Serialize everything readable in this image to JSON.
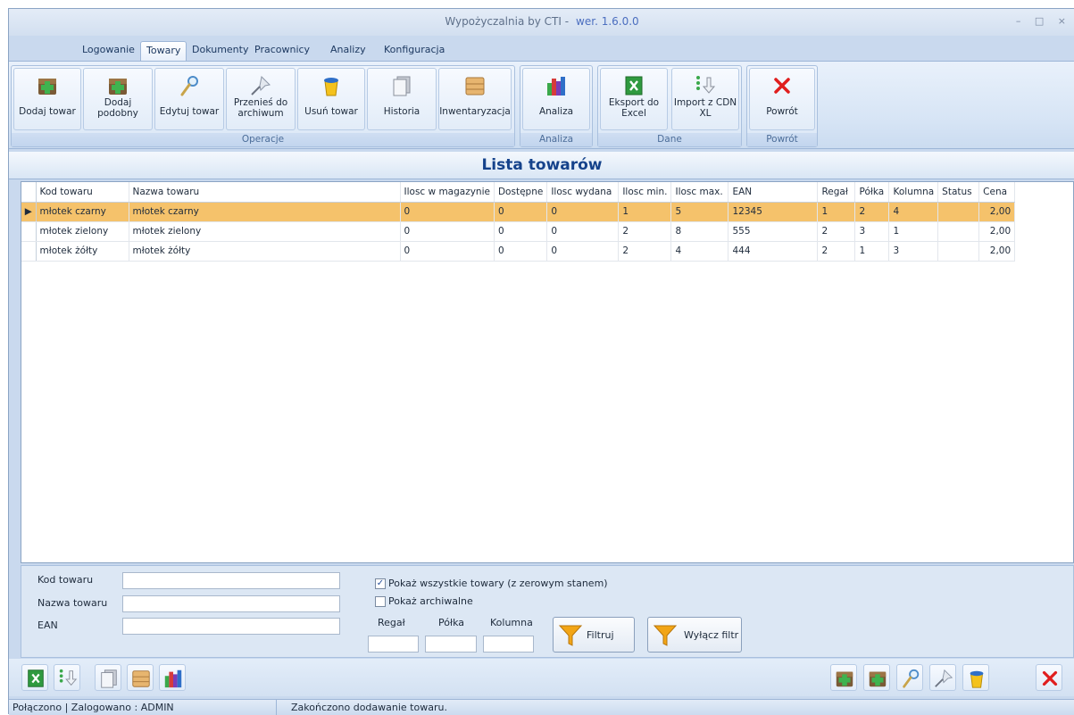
{
  "window": {
    "title": "Wypożyczalnia by CTI -",
    "version": "wer. 1.6.0.0",
    "controls": "– □ ×"
  },
  "tabs": [
    {
      "label": "Logowanie"
    },
    {
      "label": "Towary",
      "active": true
    },
    {
      "label": "Dokumenty"
    },
    {
      "label": "Pracownicy"
    },
    {
      "label": "Analizy"
    },
    {
      "label": "Konfiguracja"
    }
  ],
  "ribbon": {
    "groups": [
      {
        "label": "Operacje"
      },
      {
        "label": "Analiza"
      },
      {
        "label": "Dane"
      },
      {
        "label": "Powrót"
      }
    ],
    "buttons": {
      "add": {
        "label": "Dodaj towar",
        "icon": "add-box-icon"
      },
      "add_similar": {
        "label": "Dodaj podobny",
        "icon": "add-box-icon"
      },
      "edit": {
        "label": "Edytuj towar",
        "icon": "magnifier-icon"
      },
      "archive": {
        "label": "Przenieś do archiwum",
        "icon": "pin-icon"
      },
      "delete": {
        "label": "Usuń towar",
        "icon": "trash-icon"
      },
      "history": {
        "label": "Historia",
        "icon": "documents-icon"
      },
      "inventory": {
        "label": "Inwentaryzacja",
        "icon": "box-icon"
      },
      "analysis": {
        "label": "Analiza",
        "icon": "books-chart-icon"
      },
      "export_excel": {
        "label": "Eksport do Excel",
        "icon": "excel-icon"
      },
      "import_cdn": {
        "label": "Import z CDN XL",
        "icon": "import-arrow-icon"
      },
      "back": {
        "label": "Powrót",
        "icon": "red-x-icon"
      }
    }
  },
  "heading": "Lista towarów",
  "table": {
    "columns": [
      "Kod towaru",
      "Nazwa towaru",
      "Ilosc w magazynie",
      "Dostępne",
      "Ilosc wydana",
      "Ilosc min.",
      "Ilosc max.",
      "EAN",
      "Regał",
      "Półka",
      "Kolumna",
      "Status",
      "Cena"
    ],
    "rows": [
      [
        "młotek czarny",
        "młotek czarny",
        "0",
        "0",
        "0",
        "1",
        "5",
        "12345",
        "1",
        "2",
        "4",
        "",
        "2,00"
      ],
      [
        "młotek zielony",
        "młotek zielony",
        "0",
        "0",
        "0",
        "2",
        "8",
        "555",
        "2",
        "3",
        "1",
        "",
        "2,00"
      ],
      [
        "młotek żółty",
        "młotek żółty",
        "0",
        "0",
        "0",
        "2",
        "4",
        "444",
        "2",
        "1",
        "3",
        "",
        "2,00"
      ]
    ],
    "selected_row": 0,
    "selected_color": "#f5c26b"
  },
  "filters": {
    "kod_label": "Kod towaru",
    "nazwa_label": "Nazwa towaru",
    "ean_label": "EAN",
    "show_all_label": "Pokaż wszystkie towary (z zerowym stanem)",
    "show_all_checked": true,
    "show_archived_label": "Pokaż archiwalne",
    "show_archived_checked": false,
    "regal_label": "Regał",
    "polka_label": "Półka",
    "kolumna_label": "Kolumna",
    "filter_button": "Filtruj",
    "clear_filter_button": "Wyłącz filtr"
  },
  "status": {
    "connection": "Połączono | Zalogowano : ADMIN",
    "message": "Zakończono dodawanie towaru."
  },
  "colors": {
    "accent": "#15428b",
    "ribbon": "#d6e4f5"
  }
}
